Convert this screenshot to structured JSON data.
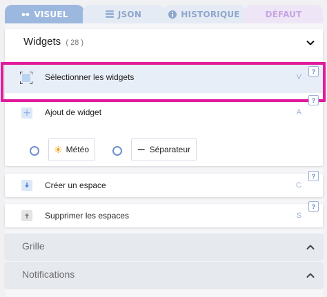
{
  "tabs": [
    {
      "label": "VISUEL",
      "icon": "glasses-icon"
    },
    {
      "label": "JSON",
      "icon": "database-icon"
    },
    {
      "label": "HISTORIQUE",
      "icon": "info-icon"
    },
    {
      "label": "DÉFAUT",
      "icon": ""
    }
  ],
  "widgets": {
    "title": "Widgets",
    "count": "( 28 )",
    "items": [
      {
        "label": "Sélectionner les widgets",
        "key": "V",
        "help": "?"
      },
      {
        "label": "Ajout de widget",
        "key": "A",
        "help": "?"
      }
    ],
    "options": [
      {
        "label": "Météo",
        "icon": "sun-icon"
      },
      {
        "label": "Séparateur",
        "icon": "dash-icon"
      }
    ]
  },
  "actions": [
    {
      "label": "Créer un espace",
      "key": "C",
      "help": "?"
    },
    {
      "label": "Supprimer les espaces",
      "key": "S",
      "help": "?"
    }
  ],
  "sections": [
    {
      "title": "Grille"
    },
    {
      "title": "Notifications"
    }
  ],
  "colors": {
    "accent": "#9cb8de",
    "highlight": "#e21b9c",
    "selected_row": "#e8eef8"
  }
}
